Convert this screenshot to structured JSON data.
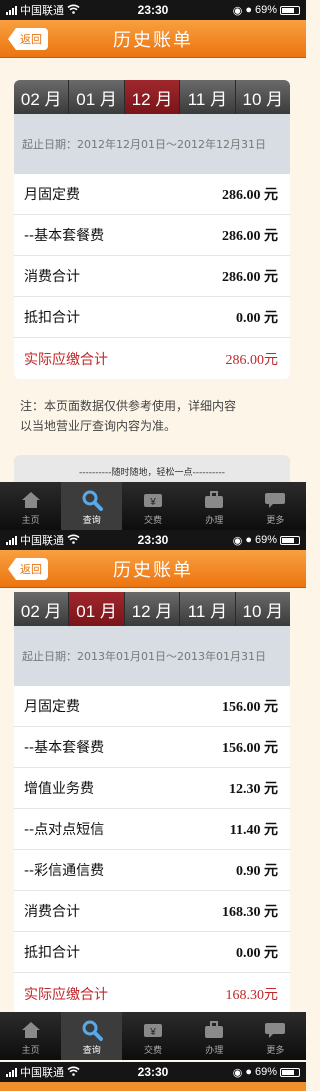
{
  "screen1": {
    "status": {
      "carrier": "中国联通",
      "time": "23:30",
      "battery": "69%"
    },
    "nav": {
      "back": "返回",
      "title": "历史账单"
    },
    "tabs": [
      {
        "label": "02 月",
        "active": false
      },
      {
        "label": "01 月",
        "active": false
      },
      {
        "label": "12 月",
        "active": true
      },
      {
        "label": "11 月",
        "active": false
      },
      {
        "label": "10 月",
        "active": false
      }
    ],
    "date_range": "起止日期：2012年12月01日～2012年12月31日",
    "rows": [
      {
        "label": "月固定费",
        "value": "286.00 元"
      },
      {
        "label": "--基本套餐费",
        "value": "286.00 元"
      },
      {
        "label": "消费合计",
        "value": "286.00 元"
      },
      {
        "label": "抵扣合计",
        "value": "0.00 元"
      },
      {
        "label": "实际应缴合计",
        "value": "286.00元",
        "total": true
      }
    ],
    "note_line1": "注：本页面数据仅供参考使用，详细内容",
    "note_line2": "以当地营业厅查询内容为准。",
    "promo": "----------随时随地，轻松一点----------",
    "tabbar": [
      {
        "label": "主页",
        "icon": "home-icon",
        "active": false
      },
      {
        "label": "查询",
        "icon": "search-icon",
        "active": true
      },
      {
        "label": "交费",
        "icon": "payment-icon",
        "active": false
      },
      {
        "label": "办理",
        "icon": "briefcase-icon",
        "active": false
      },
      {
        "label": "更多",
        "icon": "chat-bubble-icon",
        "active": false
      }
    ]
  },
  "screen2": {
    "status": {
      "carrier": "中国联通",
      "time": "23:30",
      "battery": "69%"
    },
    "nav": {
      "back": "返回",
      "title": "历史账单"
    },
    "tabs": [
      {
        "label": "02 月",
        "active": false
      },
      {
        "label": "01 月",
        "active": true
      },
      {
        "label": "12 月",
        "active": false
      },
      {
        "label": "11 月",
        "active": false
      },
      {
        "label": "10 月",
        "active": false
      }
    ],
    "date_range": "起止日期：2013年01月01日～2013年01月31日",
    "rows": [
      {
        "label": "月固定费",
        "value": "156.00 元"
      },
      {
        "label": "--基本套餐费",
        "value": "156.00 元"
      },
      {
        "label": "增值业务费",
        "value": "12.30 元"
      },
      {
        "label": "--点对点短信",
        "value": "11.40 元"
      },
      {
        "label": "--彩信通信费",
        "value": "0.90 元"
      },
      {
        "label": "消费合计",
        "value": "168.30 元"
      },
      {
        "label": "抵扣合计",
        "value": "0.00 元"
      },
      {
        "label": "实际应缴合计",
        "value": "168.30元",
        "total": true
      }
    ],
    "tabbar": [
      {
        "label": "主页",
        "icon": "home-icon",
        "active": false
      },
      {
        "label": "查询",
        "icon": "search-icon",
        "active": true
      },
      {
        "label": "交费",
        "icon": "payment-icon",
        "active": false
      },
      {
        "label": "办理",
        "icon": "briefcase-icon",
        "active": false
      },
      {
        "label": "更多",
        "icon": "chat-bubble-icon",
        "active": false
      }
    ]
  },
  "screen3": {
    "status": {
      "carrier": "中国联通",
      "time": "23:30",
      "battery": "69%"
    }
  },
  "colors": {
    "accent": "#ec7410",
    "active_tab": "#8a1c20",
    "total_text": "#c0282a"
  }
}
